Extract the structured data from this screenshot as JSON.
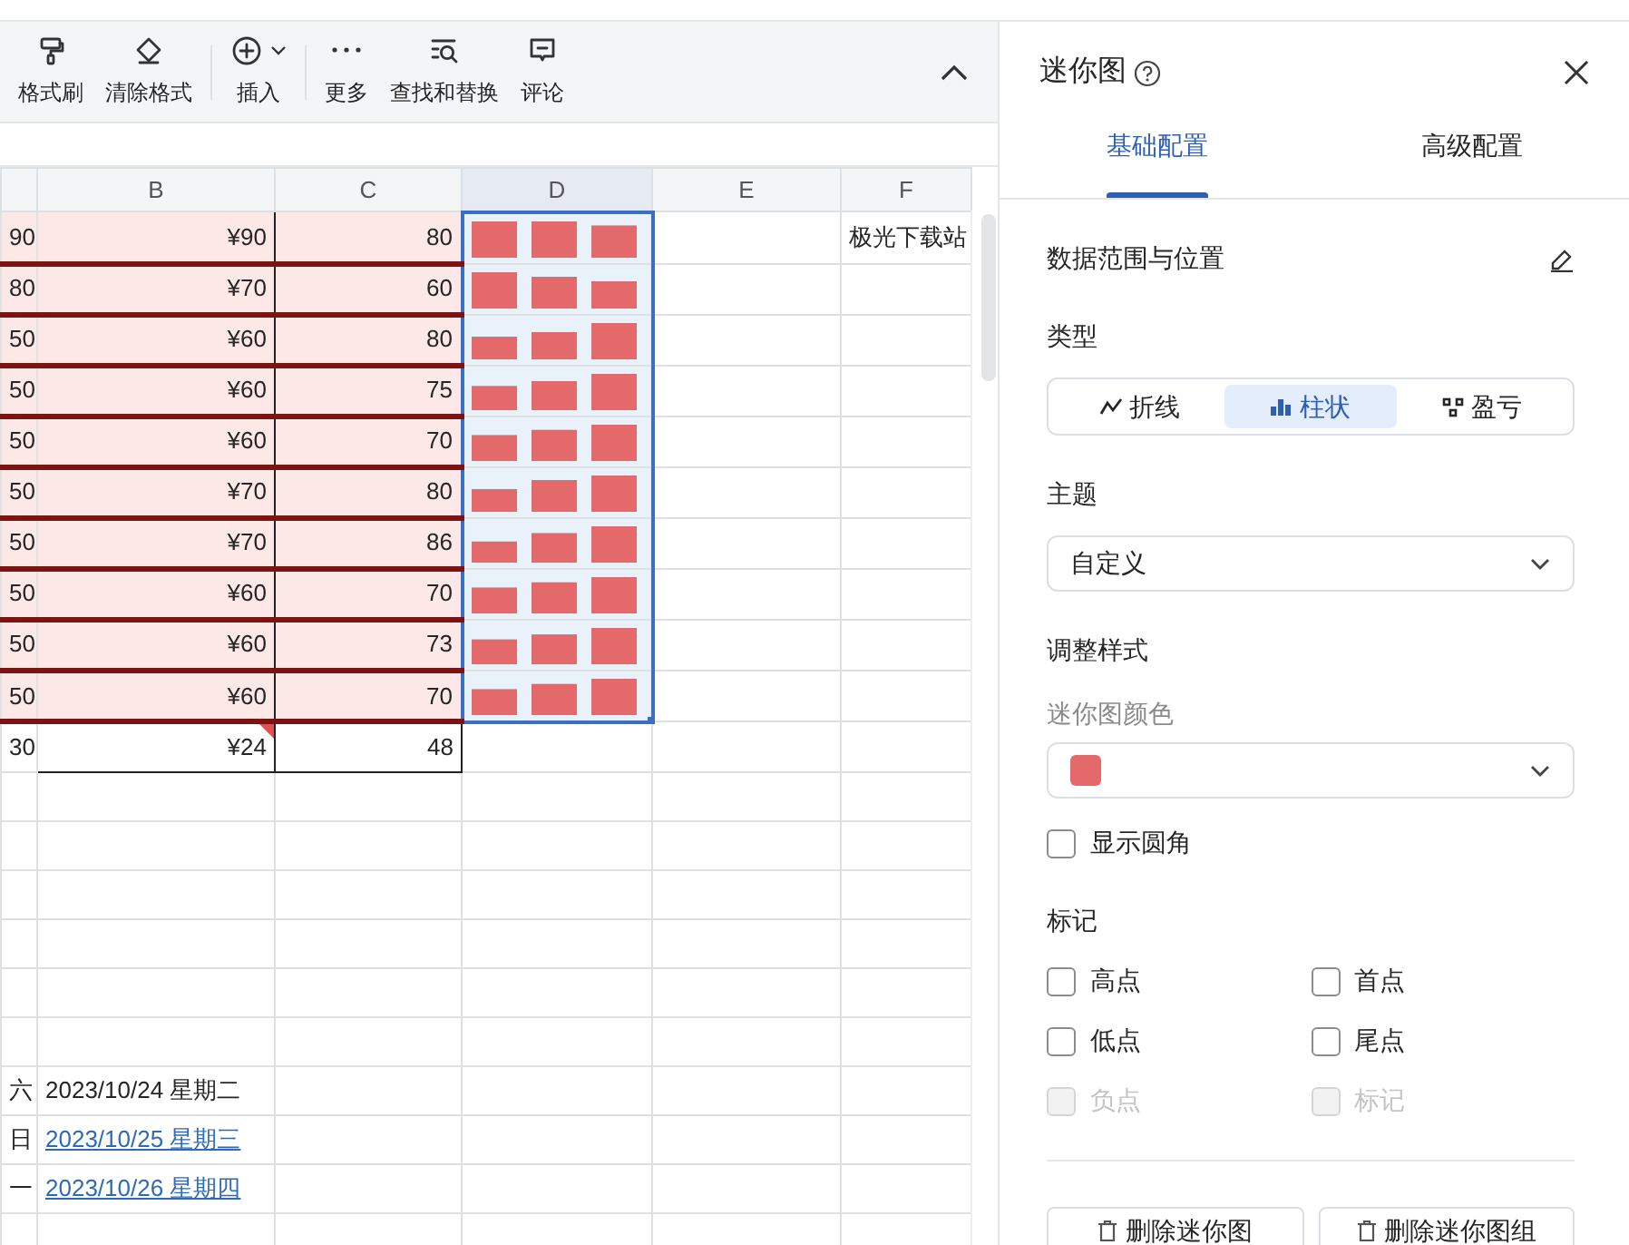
{
  "toolbar": {
    "groups": [
      [
        {
          "label": "格式刷",
          "menu": false
        },
        {
          "label": "清除格式",
          "menu": false
        }
      ],
      [
        {
          "label": "插入",
          "menu": true
        }
      ],
      [
        {
          "label": "更多",
          "menu": false
        },
        {
          "label": "查找和替换",
          "menu": false
        },
        {
          "label": "评论",
          "menu": false
        }
      ]
    ]
  },
  "sheet": {
    "columns": [
      {
        "label": "B",
        "selected": false
      },
      {
        "label": "C",
        "selected": false
      },
      {
        "label": "D",
        "selected": true
      },
      {
        "label": "E",
        "selected": false
      },
      {
        "label": "F",
        "selected": false
      }
    ],
    "rows": [
      {
        "kind": "highlight",
        "a": "90",
        "b": "¥90",
        "c": "80",
        "f": "极光下载站"
      },
      {
        "kind": "highlight",
        "a": "80",
        "b": "¥70",
        "c": "60"
      },
      {
        "kind": "highlight",
        "a": "50",
        "b": "¥60",
        "c": "80"
      },
      {
        "kind": "highlight",
        "a": "50",
        "b": "¥60",
        "c": "75"
      },
      {
        "kind": "highlight",
        "a": "50",
        "b": "¥60",
        "c": "70"
      },
      {
        "kind": "highlight",
        "a": "50",
        "b": "¥70",
        "c": "80"
      },
      {
        "kind": "highlight",
        "a": "50",
        "b": "¥70",
        "c": "86"
      },
      {
        "kind": "highlight",
        "a": "50",
        "b": "¥60",
        "c": "70"
      },
      {
        "kind": "highlight",
        "a": "50",
        "b": "¥60",
        "c": "73"
      },
      {
        "kind": "highlight",
        "a": "50",
        "b": "¥60",
        "c": "70"
      },
      {
        "kind": "total",
        "a": "30",
        "b": "¥24",
        "c": "48",
        "comment": true
      },
      {
        "kind": "blank"
      },
      {
        "kind": "blank"
      },
      {
        "kind": "blank"
      },
      {
        "kind": "blank"
      },
      {
        "kind": "blank"
      },
      {
        "kind": "blank"
      },
      {
        "kind": "date",
        "a": "六",
        "b": "2023/10/24 星期二"
      },
      {
        "kind": "link",
        "a": "日",
        "b": "2023/10/25 星期三"
      },
      {
        "kind": "link",
        "a": "一",
        "b": "2023/10/26 星期四"
      },
      {
        "kind": "blank"
      }
    ]
  },
  "panel": {
    "title": "迷你图",
    "tabs": [
      {
        "label": "基础配置",
        "selected": true
      },
      {
        "label": "高级配置",
        "selected": false
      }
    ],
    "data_range_label": "数据范围与位置",
    "type_label": "类型",
    "types": [
      {
        "label": "折线",
        "selected": false
      },
      {
        "label": "柱状",
        "selected": true
      },
      {
        "label": "盈亏",
        "selected": false
      }
    ],
    "theme_label": "主题",
    "theme": {
      "value": "自定义"
    },
    "style_label": "调整样式",
    "color_label": "迷你图颜色",
    "color": "#e4696a",
    "rounded": {
      "label": "显示圆角",
      "checked": false
    },
    "markers_label": "标记",
    "markers": [
      {
        "label": "高点",
        "checked": false,
        "disabled": false
      },
      {
        "label": "首点",
        "checked": false,
        "disabled": false
      },
      {
        "label": "低点",
        "checked": false,
        "disabled": false
      },
      {
        "label": "尾点",
        "checked": false,
        "disabled": false
      },
      {
        "label": "负点",
        "checked": false,
        "disabled": true
      },
      {
        "label": "标记",
        "checked": false,
        "disabled": true
      }
    ],
    "buttons": [
      "删除迷你图",
      "删除迷你图组"
    ]
  }
}
